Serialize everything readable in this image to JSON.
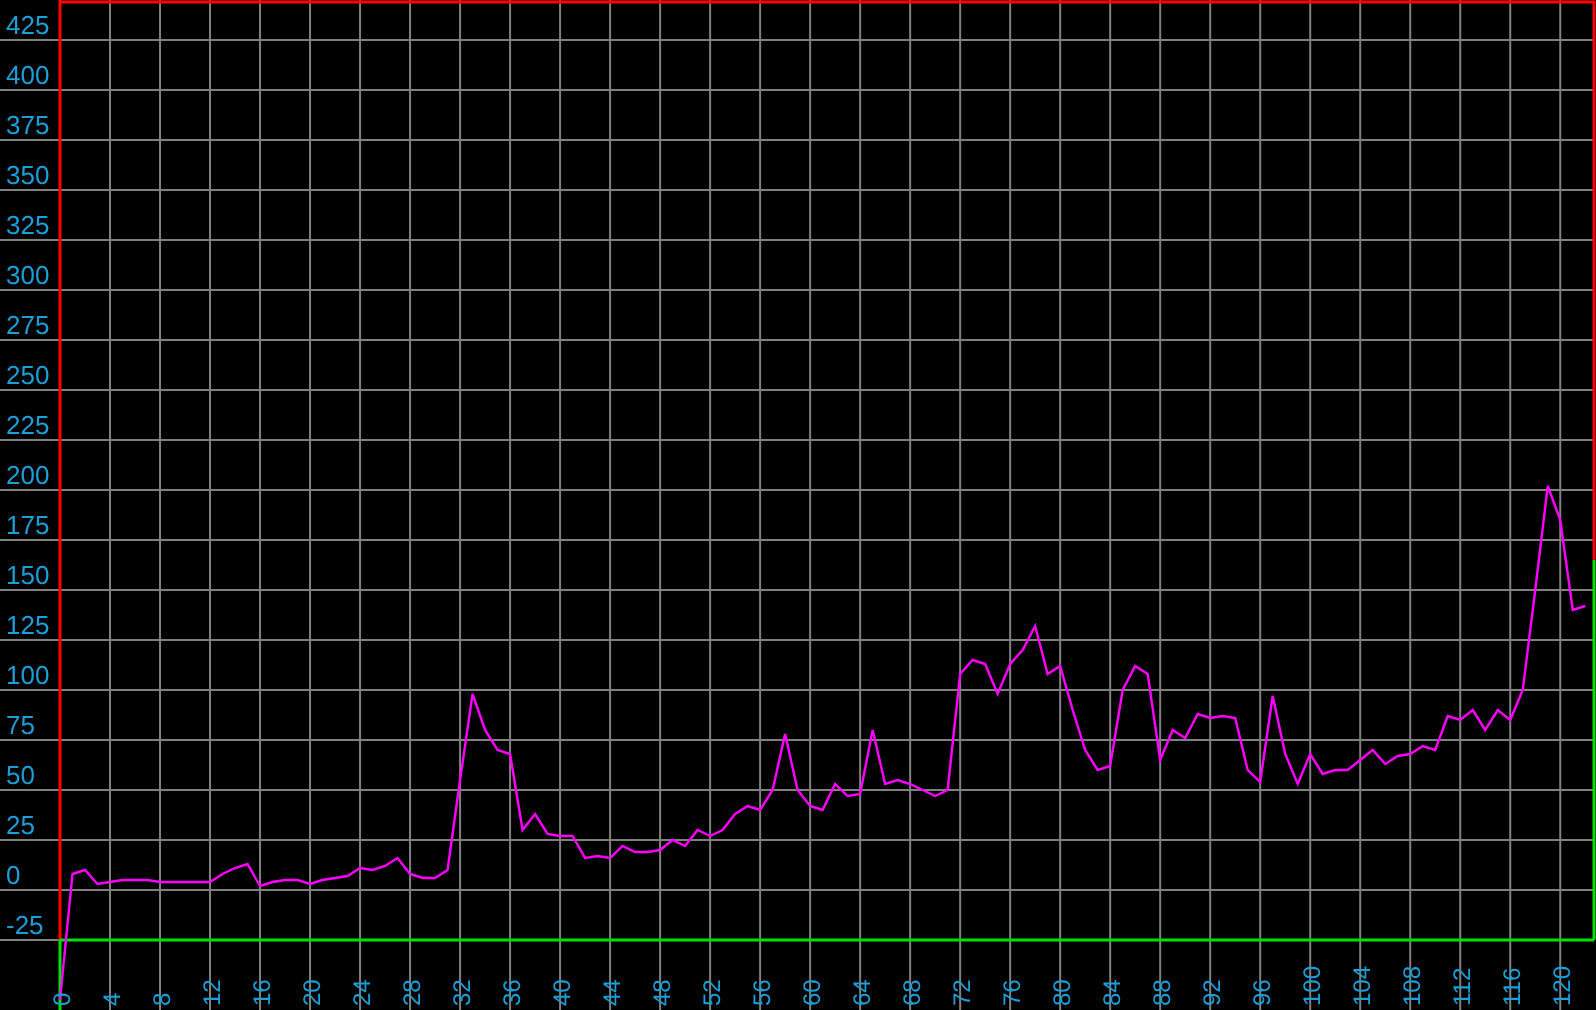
{
  "chart_data": {
    "type": "line",
    "grid": true,
    "xlim": [
      0,
      122.7
    ],
    "ylim": [
      -60,
      445
    ],
    "ref_lines": [
      {
        "axis": "y",
        "value": -25,
        "color": "#00e000"
      }
    ],
    "xticks": [
      0,
      4,
      8,
      12,
      16,
      20,
      24,
      28,
      32,
      36,
      40,
      44,
      48,
      52,
      56,
      60,
      64,
      68,
      72,
      76,
      80,
      84,
      88,
      92,
      96,
      100,
      104,
      108,
      112,
      116,
      120
    ],
    "yticks": [
      -25,
      0,
      25,
      50,
      75,
      100,
      125,
      150,
      175,
      200,
      225,
      250,
      275,
      300,
      325,
      350,
      375,
      400,
      425
    ],
    "x": [
      0,
      1,
      2,
      3,
      4,
      5,
      6,
      7,
      8,
      9,
      10,
      11,
      12,
      13,
      14,
      15,
      16,
      17,
      18,
      19,
      20,
      21,
      22,
      23,
      24,
      25,
      26,
      27,
      28,
      29,
      30,
      31,
      32,
      33,
      34,
      35,
      36,
      37,
      38,
      39,
      40,
      41,
      42,
      43,
      44,
      45,
      46,
      47,
      48,
      49,
      50,
      51,
      52,
      53,
      54,
      55,
      56,
      57,
      58,
      59,
      60,
      61,
      62,
      63,
      64,
      65,
      66,
      67,
      68,
      69,
      70,
      71,
      72,
      73,
      74,
      75,
      76,
      77,
      78,
      79,
      80,
      81,
      82,
      83,
      84,
      85,
      86,
      87,
      88,
      89,
      90,
      91,
      92,
      93,
      94,
      95,
      96,
      97,
      98,
      99,
      100,
      101,
      102,
      103,
      104,
      105,
      106,
      107,
      108,
      109,
      110,
      111,
      112,
      113,
      114,
      115,
      116,
      117,
      118,
      119,
      120,
      121,
      122
    ],
    "series": [
      {
        "color": "#ff00ff",
        "values": [
          -55,
          8,
          10,
          3,
          4,
          5,
          5,
          5,
          4,
          4,
          4,
          4,
          4,
          8,
          11,
          13,
          2,
          4,
          5,
          5,
          3,
          5,
          6,
          7,
          11,
          10,
          12,
          16,
          8,
          6,
          6,
          10,
          55,
          98,
          80,
          70,
          68,
          30,
          38,
          28,
          27,
          27,
          16,
          17,
          16,
          22,
          19,
          19,
          20,
          25,
          22,
          30,
          27,
          30,
          38,
          42,
          40,
          50,
          78,
          50,
          42,
          40,
          53,
          47,
          48,
          80,
          53,
          55,
          53,
          50,
          47,
          50,
          108,
          115,
          113,
          98,
          113,
          120,
          132,
          108,
          112,
          90,
          70,
          60,
          62,
          100,
          112,
          108,
          65,
          80,
          76,
          88,
          86,
          87,
          86,
          60,
          54,
          97,
          68,
          53,
          68,
          58,
          60,
          60,
          65,
          70,
          63,
          67,
          68,
          72,
          70,
          87,
          85,
          90,
          80,
          90,
          85,
          100,
          150,
          202,
          185,
          140,
          142
        ]
      }
    ]
  }
}
